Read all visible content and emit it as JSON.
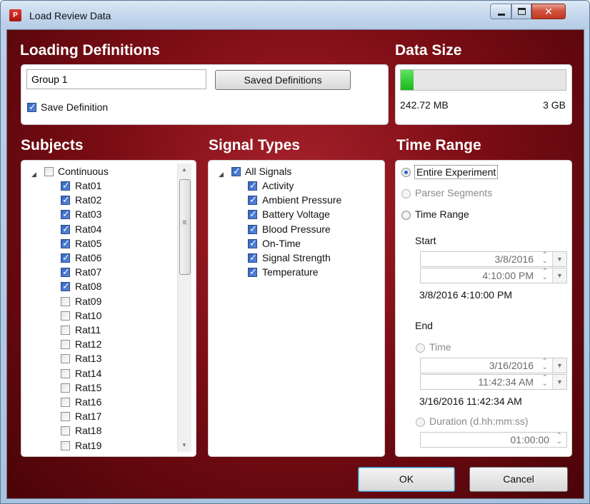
{
  "window": {
    "title": "Load Review Data",
    "icon_text": "P"
  },
  "loading_definitions": {
    "heading": "Loading Definitions",
    "group_value": "Group 1",
    "saved_definitions_label": "Saved Definitions",
    "save_definition_label": "Save Definition",
    "save_definition_checked": true
  },
  "data_size": {
    "heading": "Data Size",
    "used": "242.72 MB",
    "total": "3 GB",
    "fill_fraction": 0.08,
    "fill_color": "#22cc22"
  },
  "subjects": {
    "heading": "Subjects",
    "root_label": "Continuous",
    "root_checked": false,
    "items": [
      {
        "label": "Rat01",
        "checked": true
      },
      {
        "label": "Rat02",
        "checked": true
      },
      {
        "label": "Rat03",
        "checked": true
      },
      {
        "label": "Rat04",
        "checked": true
      },
      {
        "label": "Rat05",
        "checked": true
      },
      {
        "label": "Rat06",
        "checked": true
      },
      {
        "label": "Rat07",
        "checked": true
      },
      {
        "label": "Rat08",
        "checked": true
      },
      {
        "label": "Rat09",
        "checked": false
      },
      {
        "label": "Rat10",
        "checked": false
      },
      {
        "label": "Rat11",
        "checked": false
      },
      {
        "label": "Rat12",
        "checked": false
      },
      {
        "label": "Rat13",
        "checked": false
      },
      {
        "label": "Rat14",
        "checked": false
      },
      {
        "label": "Rat15",
        "checked": false
      },
      {
        "label": "Rat16",
        "checked": false
      },
      {
        "label": "Rat17",
        "checked": false
      },
      {
        "label": "Rat18",
        "checked": false
      },
      {
        "label": "Rat19",
        "checked": false
      }
    ]
  },
  "signal_types": {
    "heading": "Signal Types",
    "root_label": "All Signals",
    "root_checked": true,
    "items": [
      {
        "label": "Activity",
        "checked": true
      },
      {
        "label": "Ambient Pressure",
        "checked": true
      },
      {
        "label": "Battery Voltage",
        "checked": true
      },
      {
        "label": "Blood Pressure",
        "checked": true
      },
      {
        "label": "On-Time",
        "checked": true
      },
      {
        "label": "Signal Strength",
        "checked": true
      },
      {
        "label": "Temperature",
        "checked": true
      }
    ]
  },
  "time_range": {
    "heading": "Time Range",
    "option_entire": "Entire Experiment",
    "option_parser": "Parser Segments",
    "option_range": "Time Range",
    "selected": "entire",
    "start_label": "Start",
    "start_date": "3/8/2016",
    "start_time": "4:10:00 PM",
    "start_summary": "3/8/2016 4:10:00 PM",
    "end_label": "End",
    "end_time_option": "Time",
    "end_date": "3/16/2016",
    "end_time": "11:42:34 AM",
    "end_summary": "3/16/2016 11:42:34 AM",
    "duration_option": "Duration (d.hh:mm:ss)",
    "duration_value": "01:00:00"
  },
  "footer": {
    "ok_label": "OK",
    "cancel_label": "Cancel"
  }
}
